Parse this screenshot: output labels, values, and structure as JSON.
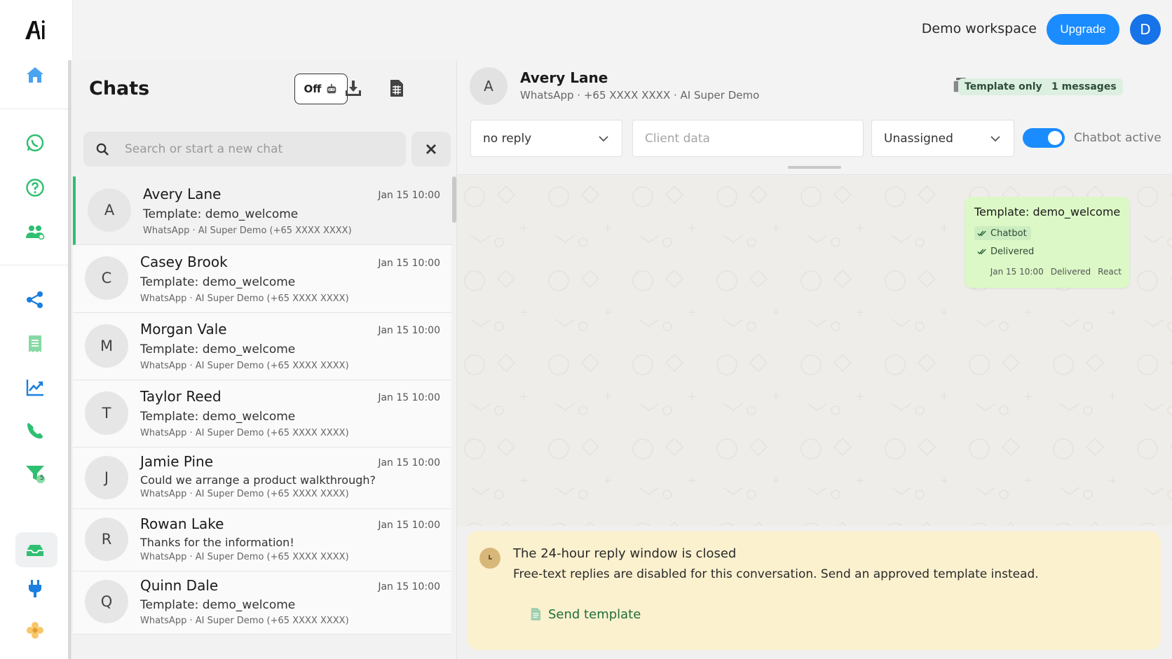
{
  "app": {
    "logo_text": "Ai"
  },
  "topbar": {
    "workspace": "Demo workspace",
    "upgrade_label": "Upgrade",
    "user_initial": "D"
  },
  "rail": {
    "icons": [
      "home-icon",
      "whatsapp-icon",
      "help-icon",
      "contacts-icon",
      "share-icon",
      "receipt-icon",
      "analytics-icon",
      "phone-icon",
      "funnel-icon",
      "inbox-icon",
      "plug-icon",
      "settings-flower-icon"
    ],
    "funnel_badge": "5",
    "colors": {
      "blue": "#1a7fe0",
      "green": "#2fbf71"
    }
  },
  "chatlist": {
    "title": "Chats",
    "bot_toggle_label": "Off",
    "search_placeholder": "Search or start a new chat",
    "rows": [
      {
        "initial": "A",
        "name": "Avery Lane",
        "time": "Jan 15  10:00",
        "message": "Template: demo_welcome",
        "source": "WhatsApp · AI Super Demo (+65 XXXX XXXX)"
      },
      {
        "initial": "C",
        "name": "Casey Brook",
        "time": "Jan 15  10:00",
        "message": "Template: demo_welcome",
        "source": "WhatsApp · AI Super Demo (+65 XXXX XXXX)"
      },
      {
        "initial": "M",
        "name": "Morgan Vale",
        "time": "Jan 15  10:00",
        "message": "Template: demo_welcome",
        "source": "WhatsApp · AI Super Demo (+65 XXXX XXXX)"
      },
      {
        "initial": "T",
        "name": "Taylor Reed",
        "time": "Jan 15  10:00",
        "message": "Template: demo_welcome",
        "source": "WhatsApp · AI Super Demo (+65 XXXX XXXX)"
      },
      {
        "initial": "J",
        "name": "Jamie Pine",
        "time": "Jan 15  10:00",
        "message": "Could we arrange a product walkthrough?",
        "source": "WhatsApp · AI Super Demo (+65 XXXX XXXX)"
      },
      {
        "initial": "R",
        "name": "Rowan Lake",
        "time": "Jan 15  10:00",
        "message": "Thanks for the information!",
        "source": "WhatsApp · AI Super Demo (+65 XXXX XXXX)"
      },
      {
        "initial": "Q",
        "name": "Quinn Dale",
        "time": "Jan 15  10:00",
        "message": "Template: demo_welcome",
        "source": "WhatsApp · AI Super Demo (+65 XXXX XXXX)"
      }
    ]
  },
  "conversation": {
    "initial": "A",
    "name": "Avery Lane",
    "subtitle": "WhatsApp · +65 XXXX XXXX · AI Super Demo",
    "badge_template": "Template only",
    "badge_messages": "1 messages",
    "status_select": "no reply",
    "client_placeholder": "Client data",
    "assignee_select": "Unassigned",
    "chatbot_label": "Chatbot active",
    "chatbot_on": true,
    "message": {
      "text": "Template: demo_welcome",
      "tag_chatbot": "Chatbot",
      "tag_delivered": "Delivered",
      "time": "Jan 15 10:00",
      "status": "Delivered",
      "react": "React"
    },
    "notice": {
      "heading": "The 24-hour reply window is closed",
      "detail": "Free-text replies are disabled for this conversation. Send an approved template instead.",
      "action": "Send template"
    }
  }
}
